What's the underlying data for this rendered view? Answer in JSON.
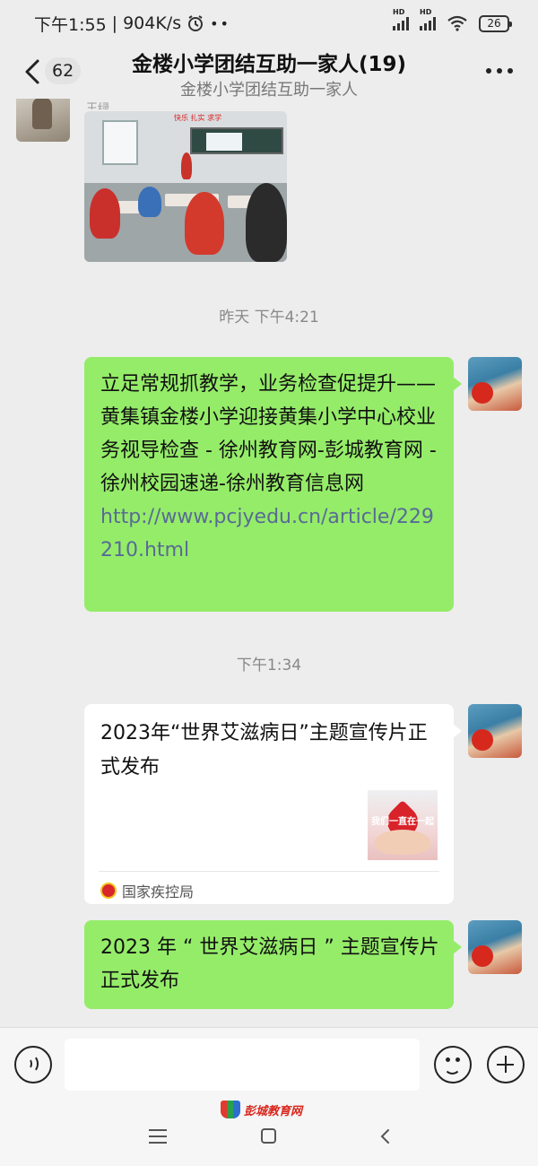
{
  "status_bar": {
    "time": "下午1:55",
    "speed": "904K/s",
    "battery": "26",
    "hd_label": "HD"
  },
  "header": {
    "unread_count": "62",
    "title": "金楼小学团结互助一家人(19)",
    "subtitle": "金楼小学团结互助一家人"
  },
  "messages": {
    "photo_sender_name": "王绿",
    "photo_banner": "快乐 扎实 求学",
    "time_1": "昨天 下午4:21",
    "link_message": {
      "text": "立足常规抓教学，业务检查促提升——黄集镇金楼小学迎接黄集小学中心校业务视导检查 - 徐州教育网-彭城教育网 - 徐州校园速递-徐州教育信息网\n",
      "url": "http://www.pcjyedu.cn/article/229210.html"
    },
    "time_2": "下午1:34",
    "card": {
      "title": "2023年“世界艾滋病日”主题宣传片正式发布",
      "thumb_text": "我们一直在一起",
      "source": "国家疾控局"
    },
    "text_message": "2023 年 “ 世界艾滋病日 ” 主题宣传片正式发布"
  },
  "input": {
    "value": "",
    "placeholder": ""
  },
  "watermark": {
    "text": "彭城教育网"
  },
  "icons": [
    "back-icon",
    "more-icon",
    "voice-icon",
    "emoji-icon",
    "plus-icon",
    "emblem-icon",
    "nav-menu-icon",
    "nav-home-icon",
    "nav-back-icon"
  ],
  "colors": {
    "background": "#ededed",
    "sent_bubble": "#95ec69",
    "link": "#576b95",
    "card": "#ffffff"
  }
}
